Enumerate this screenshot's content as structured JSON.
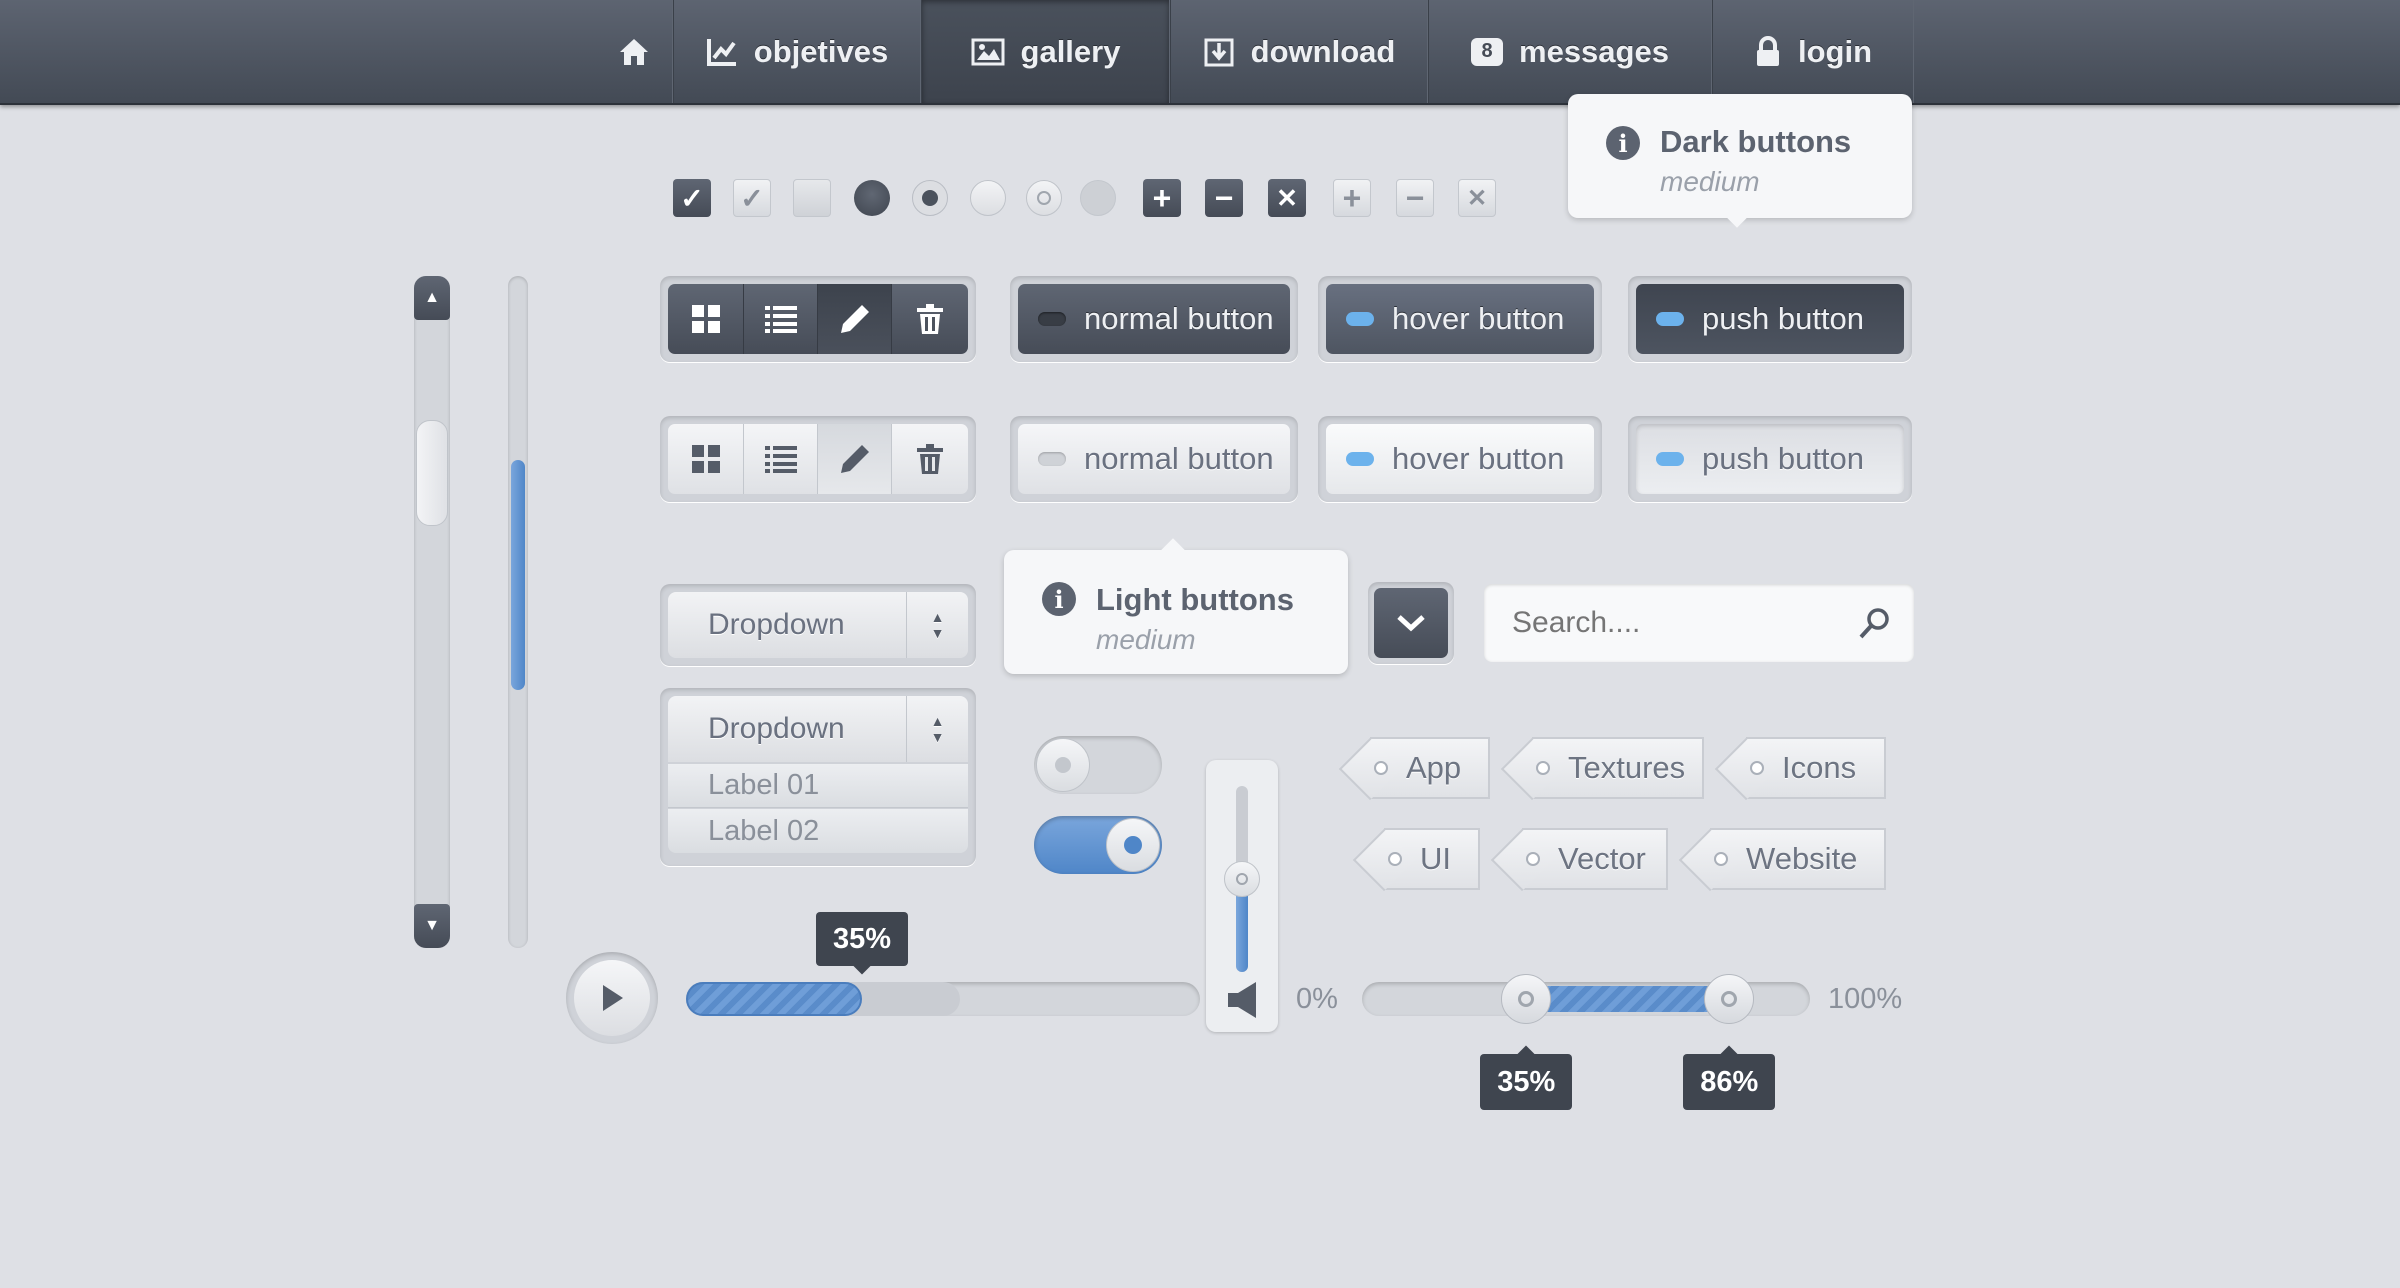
{
  "nav": {
    "items": [
      {
        "label": "",
        "icon": "home-icon"
      },
      {
        "label": "objetives",
        "icon": "chart-icon"
      },
      {
        "label": "gallery",
        "icon": "image-icon",
        "active": true
      },
      {
        "label": "download",
        "icon": "download-icon"
      },
      {
        "label": "messages",
        "icon": "messages-icon",
        "badge": "8"
      },
      {
        "label": "login",
        "icon": "lock-icon"
      }
    ]
  },
  "tooltips": {
    "dark": {
      "title": "Dark buttons",
      "subtitle": "medium"
    },
    "light": {
      "title": "Light buttons",
      "subtitle": "medium"
    }
  },
  "buttons": {
    "dark": {
      "normal": "normal button",
      "hover": "hover button",
      "push": "push button"
    },
    "light": {
      "normal": "normal button",
      "hover": "hover button",
      "push": "push button"
    }
  },
  "dropdown": {
    "closed_label": "Dropdown",
    "open_label": "Dropdown",
    "options": [
      "Label 01",
      "Label 02"
    ]
  },
  "search": {
    "placeholder": "Search...."
  },
  "tags": [
    "App",
    "Textures",
    "Icons",
    "UI",
    "Vector",
    "Website"
  ],
  "progress": {
    "value_label": "35%",
    "value": 0.35
  },
  "range": {
    "min_label": "0%",
    "max_label": "100%",
    "low_label": "35%",
    "high_label": "86%",
    "low": 0.35,
    "high": 0.86
  },
  "volume": {
    "value": 0.5
  },
  "colors": {
    "accent": "#5b8fd0",
    "dark": "#4b525d",
    "bg": "#dee0e5"
  }
}
